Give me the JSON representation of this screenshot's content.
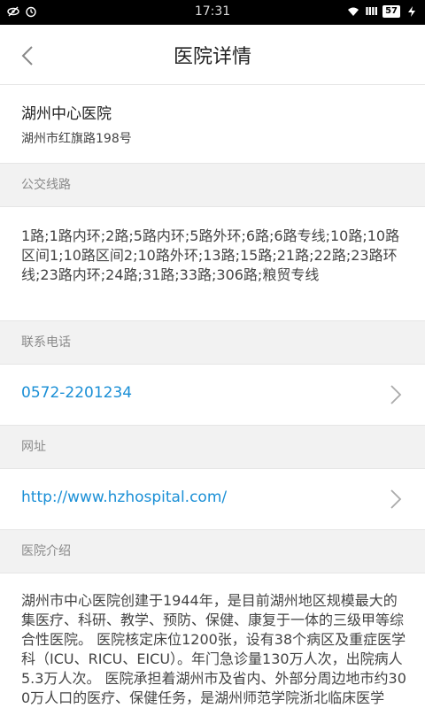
{
  "status_bar": {
    "time": "17:31",
    "battery": "57",
    "signal_label": "IIII"
  },
  "header": {
    "title": "医院详情"
  },
  "hospital": {
    "name": "湖州中心医院",
    "address": "湖州市红旗路198号"
  },
  "sections": {
    "bus_label": "公交线路",
    "bus_routes": "1路;1路内环;2路;5路内环;5路外环;6路;6路专线;10路;10路区间1;10路区间2;10路外环;13路;15路;21路;22路;23路环线;23路内环;24路;31路;33路;306路;粮贸专线",
    "phone_label": "联系电话",
    "phone": "0572-2201234",
    "website_label": "网址",
    "website": "http://www.hzhospital.com/",
    "intro_label": "医院介绍",
    "intro": "湖州市中心医院创建于1944年，是目前湖州地区规模最大的集医疗、科研、教学、预防、保健、康复于一体的三级甲等综合性医院。 医院核定床位1200张，设有38个病区及重症医学科（ICU、RICU、EICU）。年门急诊量130万人次，出院病人5.3万人次。 医院承担着湖州市及省内、外部分周边地市约300万人口的医疗、保健任务，是湖州师范学院浙北临床医学"
  },
  "colors": {
    "link": "#1a8fd6",
    "section_bg": "#f2f2f2",
    "section_text": "#8a8a8a"
  },
  "icons": {
    "back": "chevron-left-icon",
    "row_arrow": "chevron-right-icon"
  }
}
